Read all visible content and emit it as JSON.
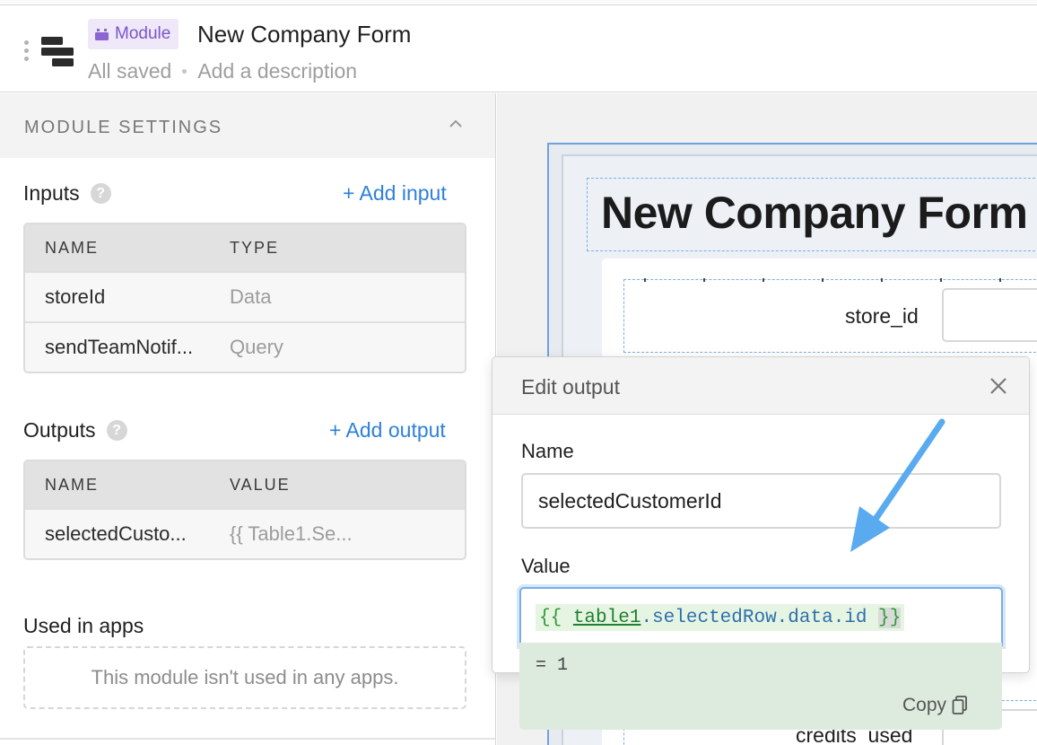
{
  "header": {
    "badge_label": "Module",
    "title": "New Company Form",
    "status": "All saved",
    "add_description": "Add a description"
  },
  "settings": {
    "section_label": "MODULE SETTINGS",
    "inputs": {
      "title": "Inputs",
      "add_label": "+ Add input",
      "columns": [
        "NAME",
        "TYPE"
      ],
      "rows": [
        {
          "name": "storeId",
          "type": "Data"
        },
        {
          "name": "sendTeamNotif...",
          "type": "Query"
        }
      ]
    },
    "outputs": {
      "title": "Outputs",
      "add_label": "+ Add output",
      "columns": [
        "NAME",
        "VALUE"
      ],
      "rows": [
        {
          "name": "selectedCusto...",
          "value": "{{ Table1.Se..."
        }
      ]
    },
    "used_in_apps": {
      "title": "Used in apps",
      "empty_text": "This module isn't used in any apps."
    }
  },
  "canvas": {
    "form_title": "New Company Form",
    "fields": [
      "store_id",
      "credits_used"
    ]
  },
  "edit_output": {
    "title": "Edit output",
    "name_label": "Name",
    "name_value": "selectedCustomerId",
    "value_label": "Value",
    "value_code": {
      "open": "{{",
      "ident": "table1",
      "rest": ".selectedRow.data.id",
      "close": "}}"
    },
    "evaluated": "= 1",
    "copy_label": "Copy"
  },
  "colors": {
    "accent": "#2f80d9",
    "badge_text": "#7b55c7",
    "badge_bg": "#efe8f9",
    "arrow": "#5aaaf0",
    "eval_bg": "#dcebdd"
  }
}
